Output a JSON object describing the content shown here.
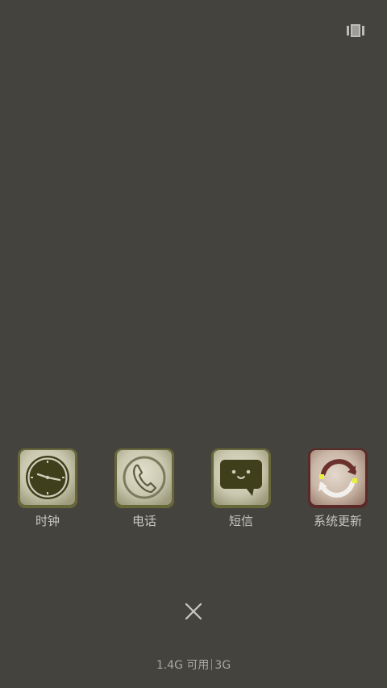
{
  "header": {
    "menu_icon": "recent-apps-icon"
  },
  "apps": [
    {
      "label": "时钟",
      "icon": "clock-icon"
    },
    {
      "label": "电话",
      "icon": "phone-icon"
    },
    {
      "label": "短信",
      "icon": "message-icon"
    },
    {
      "label": "系统更新",
      "icon": "system-update-icon"
    }
  ],
  "close": {
    "icon": "close-icon"
  },
  "memory": {
    "available": "1.4G 可用",
    "network": "3G"
  },
  "colors": {
    "background": "#45433e",
    "icon_tile": "#cfcdb8",
    "icon_glyph": "#3f3f1c",
    "update_frame": "#5a2a28",
    "update_highlight": "#e8f040"
  }
}
